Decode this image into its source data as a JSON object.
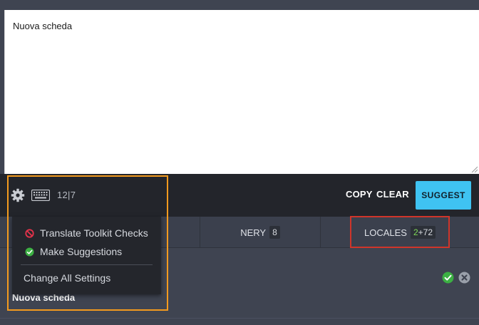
{
  "editor": {
    "text": "Nuova scheda"
  },
  "toolbar": {
    "char_count": "12|7",
    "copy_label": "COPY",
    "clear_label": "CLEAR",
    "suggest_label": "SUGGEST"
  },
  "settings_menu": {
    "items": [
      {
        "label": "Translate Toolkit Checks",
        "icon": "prohibited-icon",
        "enabled": false
      },
      {
        "label": "Make Suggestions",
        "icon": "check-circle-icon",
        "enabled": true
      }
    ],
    "change_all_label": "Change All Settings"
  },
  "tabs": {
    "nery": {
      "label": "NERY",
      "count": "8"
    },
    "locales": {
      "label": "LOCALES",
      "count_primary": "2",
      "count_rest": "+72"
    }
  },
  "result": {
    "text": "Nuova scheda"
  },
  "colors": {
    "accent": "#3fc3f2",
    "success": "#3cb043",
    "error": "#e5334b",
    "highlight_orange": "#f39a1e",
    "highlight_red": "#d0352a"
  }
}
